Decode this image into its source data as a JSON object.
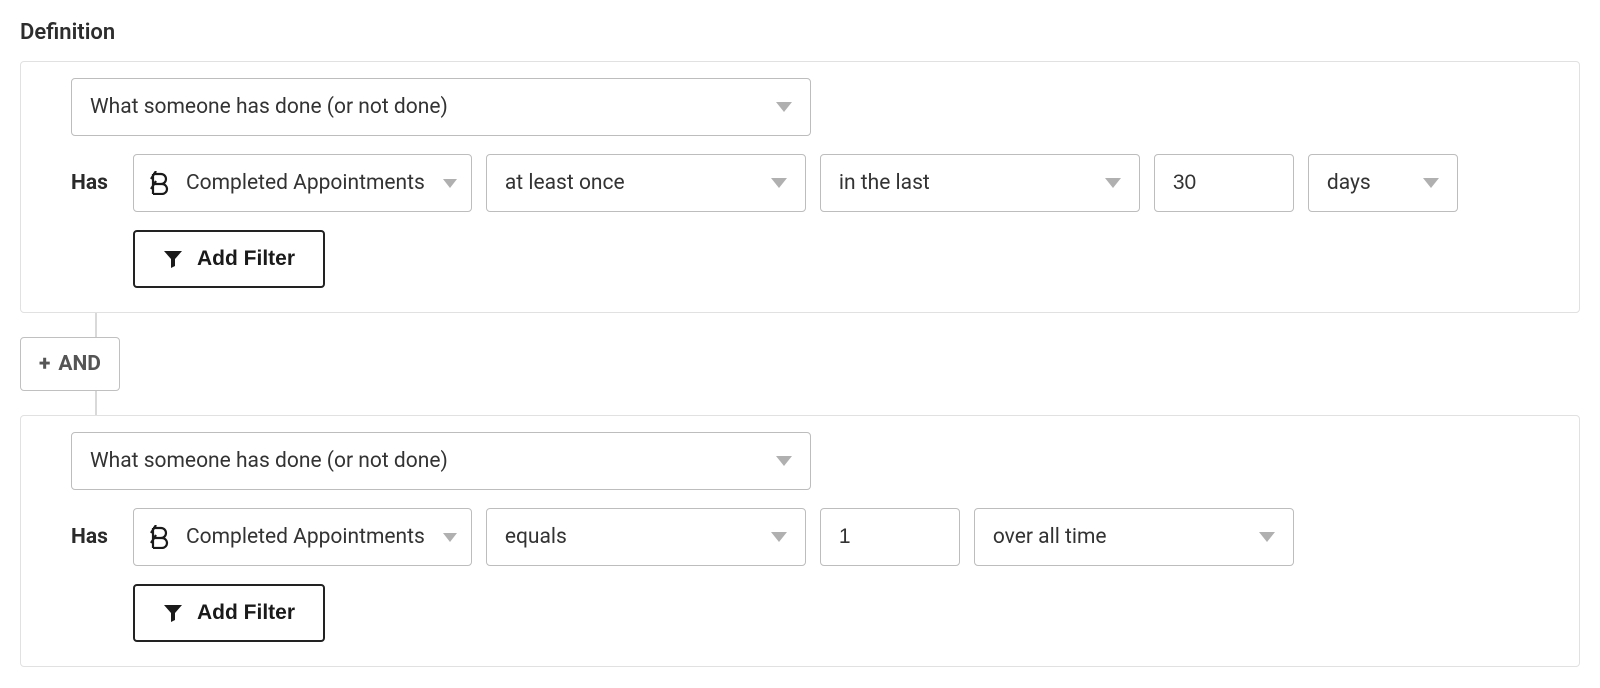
{
  "section_title": "Definition",
  "and_label": "AND",
  "plus_symbol": "+",
  "conditions": [
    {
      "type_select": "What someone has done (or not done)",
      "has_label": "Has",
      "metric": "Completed Appointments",
      "qualifiers": {
        "frequency": "at least once",
        "timeframe": "in the last",
        "number": "30",
        "unit": "days"
      },
      "add_filter_label": "Add Filter"
    },
    {
      "type_select": "What someone has done (or not done)",
      "has_label": "Has",
      "metric": "Completed Appointments",
      "qualifiers": {
        "operator": "equals",
        "value": "1",
        "timeframe": "over all time"
      },
      "add_filter_label": "Add Filter"
    }
  ]
}
